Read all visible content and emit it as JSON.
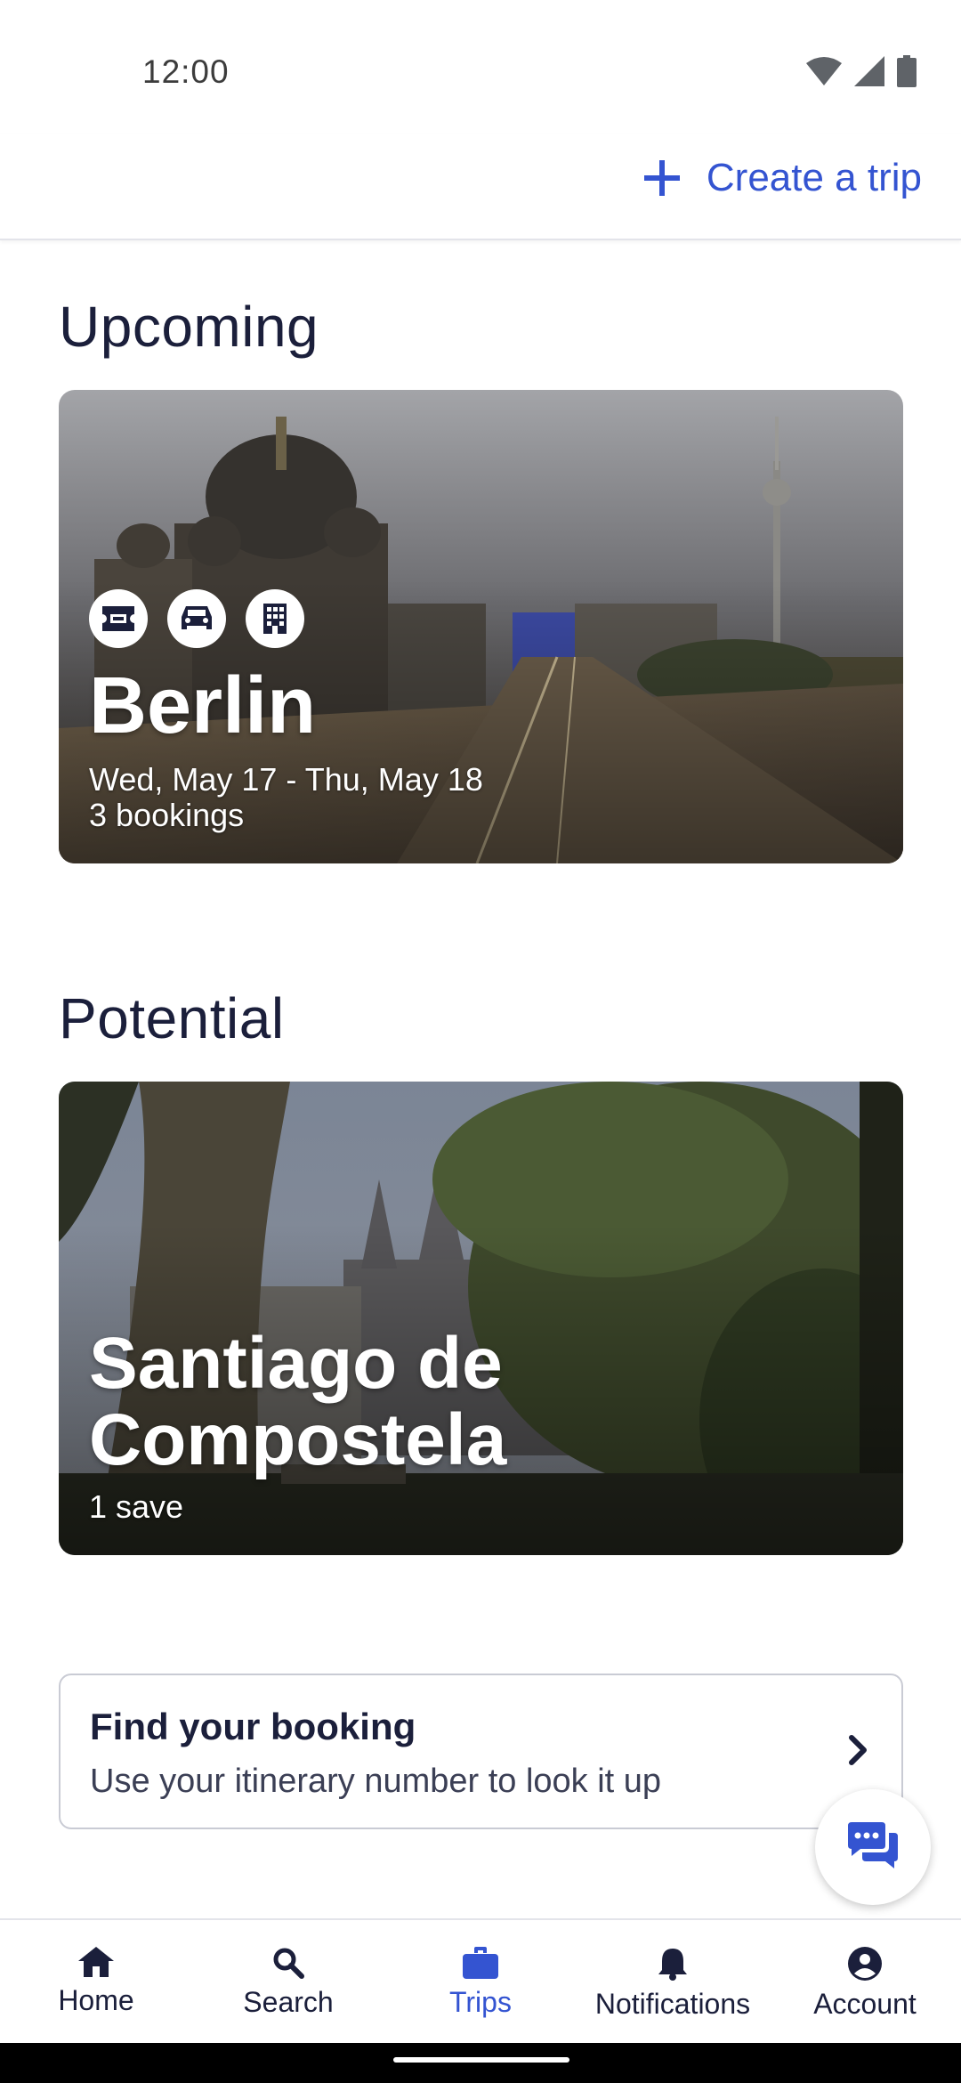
{
  "status_bar": {
    "time": "12:00"
  },
  "top_bar": {
    "create_trip_label": "Create a trip"
  },
  "upcoming": {
    "heading": "Upcoming",
    "trip": {
      "city": "Berlin",
      "dates": "Wed, May 17 - Thu, May 18",
      "bookings": "3 bookings",
      "booking_icons": [
        "ticket-icon",
        "car-icon",
        "hotel-icon"
      ]
    }
  },
  "potential": {
    "heading": "Potential",
    "trip": {
      "city_line1": "Santiago de",
      "city_line2": "Compostela",
      "saves": "1 save"
    }
  },
  "find_booking": {
    "title": "Find your booking",
    "subtitle": "Use your itinerary number to look it up"
  },
  "bottom_nav": {
    "items": [
      {
        "label": "Home",
        "icon": "home-icon"
      },
      {
        "label": "Search",
        "icon": "search-icon"
      },
      {
        "label": "Trips",
        "icon": "briefcase-icon",
        "active": true
      },
      {
        "label": "Notifications",
        "icon": "bell-icon"
      },
      {
        "label": "Account",
        "icon": "account-icon"
      }
    ]
  },
  "colors": {
    "accent": "#3454d1",
    "text_primary": "#1b1f3b",
    "divider": "#e3e4ea"
  }
}
